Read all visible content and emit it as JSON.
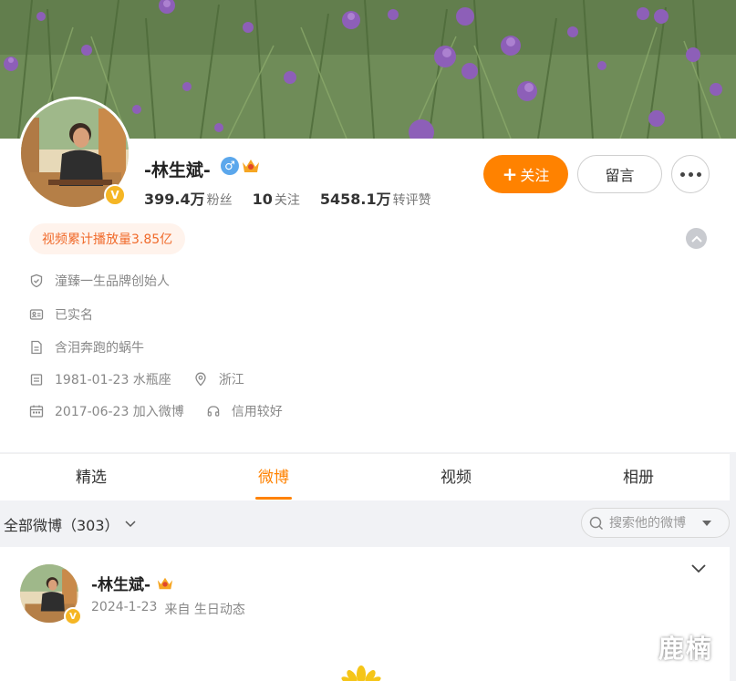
{
  "profile": {
    "name": "-林生斌-",
    "gender": "♂",
    "verified_mark": "V",
    "stats": [
      {
        "value": "399.4万",
        "label": "粉丝"
      },
      {
        "value": "10",
        "label": "关注"
      },
      {
        "value": "5458.1万",
        "label": "转评赞"
      }
    ],
    "follow_label": "关注",
    "message_label": "留言",
    "play_badge": "视频累计播放量3.85亿",
    "info": {
      "brand": "潼臻一生品牌创始人",
      "realname": "已实名",
      "bio": "含泪奔跑的蜗牛",
      "birthday": "1981-01-23 水瓶座",
      "location": "浙江",
      "joined": "2017-06-23 加入微博",
      "credit": "信用较好"
    }
  },
  "tabs": [
    "精选",
    "微博",
    "视频",
    "相册"
  ],
  "active_tab": "微博",
  "filter": {
    "label": "全部微博（303）",
    "search_placeholder": "搜索他的微博"
  },
  "post": {
    "author": "-林生斌-",
    "date": "2024-1-23",
    "source": "来自 生日动态"
  },
  "watermark": "鹿楠",
  "colors": {
    "accent": "#ff8200",
    "badge_text": "#f06a2a",
    "verified": "#f5b625",
    "gender": "#5ba7ec"
  }
}
